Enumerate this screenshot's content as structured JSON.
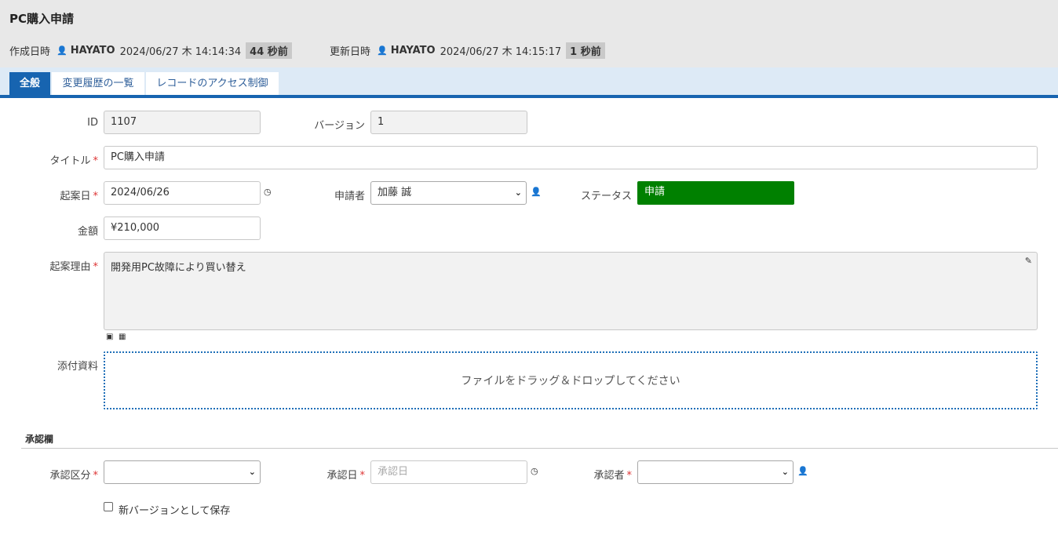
{
  "header": {
    "title": "PC購入申請",
    "created": {
      "label": "作成日時",
      "user": "HAYATO",
      "datetime": "2024/06/27 木 14:14:34",
      "ago": "44 秒前"
    },
    "updated": {
      "label": "更新日時",
      "user": "HAYATO",
      "datetime": "2024/06/27 木 14:15:17",
      "ago": "1 秒前"
    }
  },
  "tabs": [
    {
      "label": "全般",
      "active": true
    },
    {
      "label": "変更履歴の一覧",
      "active": false
    },
    {
      "label": "レコードのアクセス制御",
      "active": false
    }
  ],
  "form": {
    "id": {
      "label": "ID",
      "value": "1107"
    },
    "version": {
      "label": "バージョン",
      "value": "1"
    },
    "title": {
      "label": "タイトル",
      "value": "PC購入申請"
    },
    "proposal_date": {
      "label": "起案日",
      "value": "2024/06/26"
    },
    "applicant": {
      "label": "申請者",
      "value": "加藤 誠"
    },
    "status": {
      "label": "ステータス",
      "value": "申請",
      "color": "#008000"
    },
    "amount": {
      "label": "金額",
      "value": "¥210,000"
    },
    "reason": {
      "label": "起案理由",
      "value": "開発用PC故障により買い替え"
    },
    "attachments": {
      "label": "添付資料",
      "dropzone_text": "ファイルをドラッグ＆ドロップしてください"
    }
  },
  "approval": {
    "section_title": "承認欄",
    "category": {
      "label": "承認区分",
      "value": ""
    },
    "date": {
      "label": "承認日",
      "placeholder": "承認日"
    },
    "approver": {
      "label": "承認者",
      "value": ""
    }
  },
  "save_new_version": {
    "label": "新バージョンとして保存",
    "checked": false
  },
  "colors": {
    "accent": "#1764b0",
    "tab_bg": "#ddeaf6",
    "header_bg": "#e8e8e8",
    "status_bg": "#008000",
    "required": "#dd3333"
  },
  "icons": [
    "user-icon",
    "clock-icon",
    "pencil-icon",
    "image-icon",
    "table-icon",
    "chevron-down-icon"
  ]
}
